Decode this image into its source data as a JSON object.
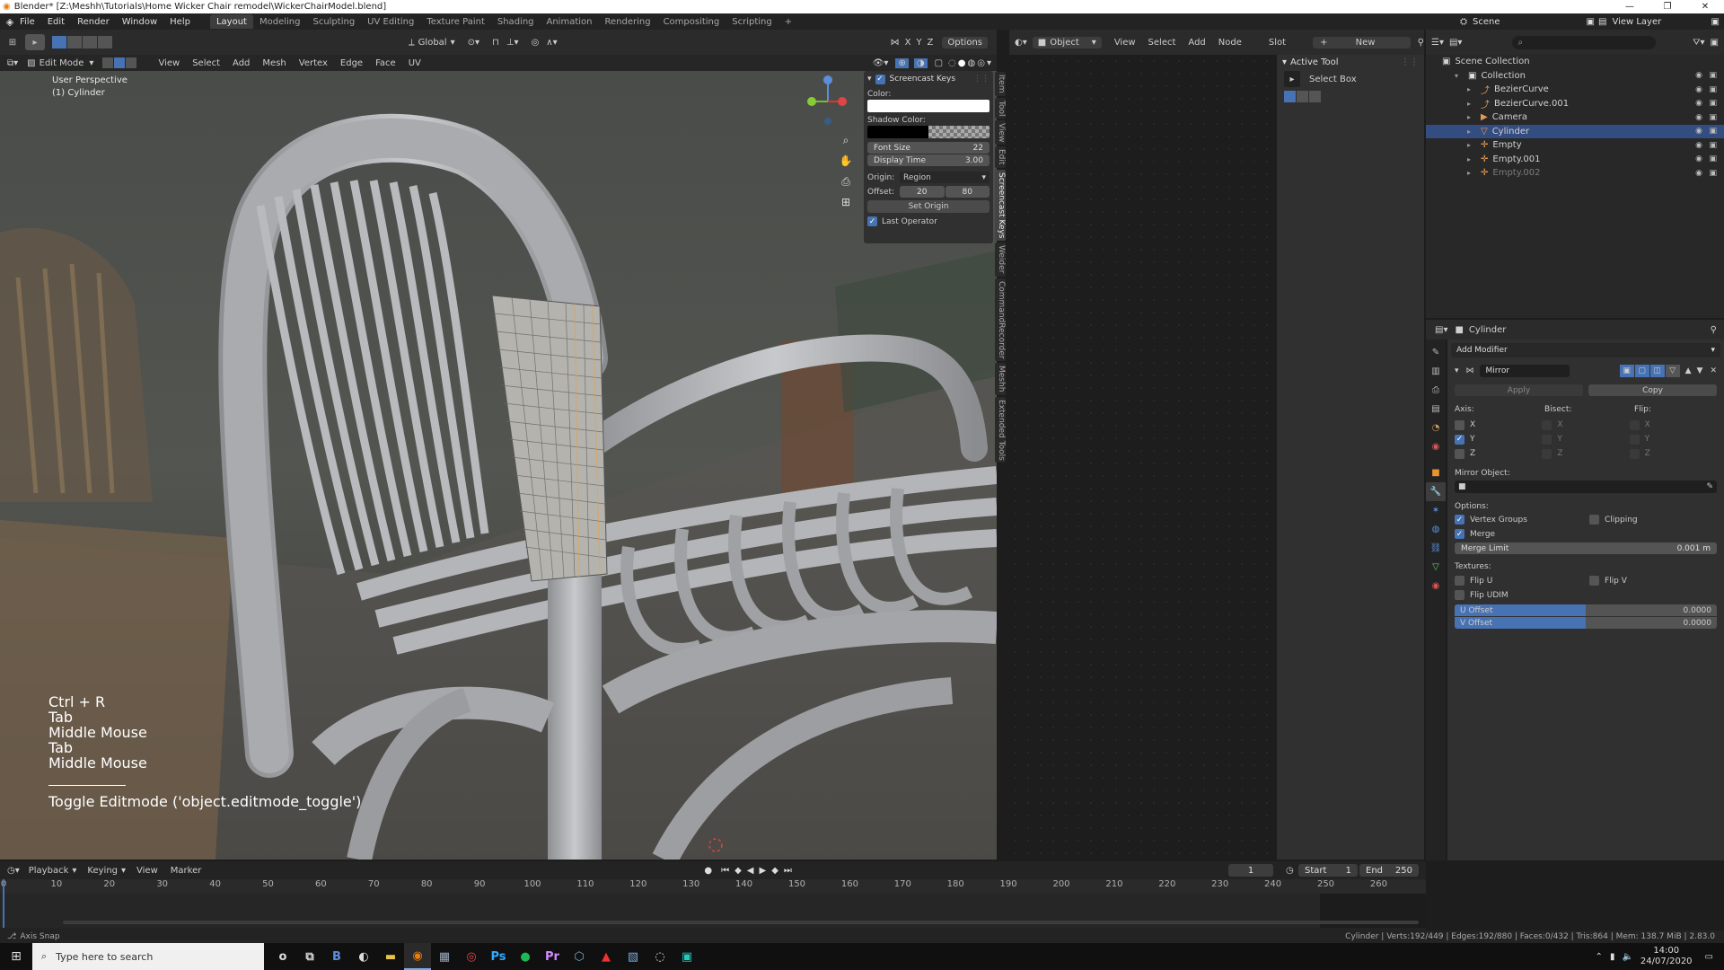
{
  "window": {
    "title": "Blender* [Z:\\Meshh\\Tutorials\\Home Wicker Chair remodel\\WickerChairModel.blend]",
    "controls": [
      "—",
      "❐",
      "✕"
    ]
  },
  "top_menu": [
    "File",
    "Edit",
    "Render",
    "Window",
    "Help"
  ],
  "workspace_tabs": [
    "Layout",
    "Modeling",
    "Sculpting",
    "UV Editing",
    "Texture Paint",
    "Shading",
    "Animation",
    "Rendering",
    "Compositing",
    "Scripting"
  ],
  "workspace_add": "+",
  "scene": {
    "name": "Scene",
    "view_layer": "View Layer"
  },
  "viewport_header": {
    "mode": "Edit Mode",
    "menus": [
      "View",
      "Select",
      "Add",
      "Mesh",
      "Vertex",
      "Edge",
      "Face",
      "UV"
    ],
    "transform": "Global",
    "axes": [
      "X",
      "Y",
      "Z"
    ],
    "options": "Options"
  },
  "viewport": {
    "perspective": "User Perspective",
    "object": "(1) Cylinder",
    "screencast_lines": [
      "Ctrl + R",
      "Tab",
      "Middle Mouse",
      "Tab",
      "Middle Mouse"
    ],
    "last_operator": "Toggle Editmode ('object.editmode_toggle')"
  },
  "screencast_panel": {
    "title": "Screencast Keys",
    "color_label": "Color:",
    "color": "#ffffff",
    "shadow_label": "Shadow Color:",
    "font_size_label": "Font Size",
    "font_size": "22",
    "display_time_label": "Display Time",
    "display_time": "3.00",
    "origin_label": "Origin:",
    "origin": "Region",
    "offset_label": "Offset:",
    "offset_x": "20",
    "offset_y": "80",
    "set_origin": "Set Origin",
    "last_operator": "Last Operator"
  },
  "sidebar_tabs": [
    "Item",
    "Tool",
    "View",
    "Edit",
    "Screencast Keys",
    "Weider",
    "CommandRecorder",
    "Meshh",
    "Extended Tools"
  ],
  "node_header": {
    "mode": "Object",
    "menus": [
      "View",
      "Select",
      "Add",
      "Node"
    ],
    "slot": "Slot",
    "new": "New"
  },
  "active_tool": {
    "title": "Active Tool",
    "tool": "Select Box"
  },
  "outliner": {
    "search_placeholder": "",
    "root": "Scene Collection",
    "items": [
      {
        "name": "Collection",
        "indent": 1,
        "icon": "collection",
        "color": "#e0e0e0"
      },
      {
        "name": "BezierCurve",
        "indent": 2,
        "icon": "curve",
        "color": "#e59c52"
      },
      {
        "name": "BezierCurve.001",
        "indent": 2,
        "icon": "curve",
        "color": "#e59c52"
      },
      {
        "name": "Camera",
        "indent": 2,
        "icon": "camera",
        "color": "#e59c52"
      },
      {
        "name": "Cylinder",
        "indent": 2,
        "icon": "mesh",
        "color": "#e59c52",
        "selected": true
      },
      {
        "name": "Empty",
        "indent": 2,
        "icon": "empty",
        "color": "#e59c52"
      },
      {
        "name": "Empty.001",
        "indent": 2,
        "icon": "empty",
        "color": "#e59c52"
      },
      {
        "name": "Empty.002",
        "indent": 2,
        "icon": "empty",
        "color": "#e59c52",
        "dim": true
      }
    ]
  },
  "properties": {
    "object": "Cylinder",
    "add_modifier": "Add Modifier",
    "modifier_name": "Mirror",
    "apply": "Apply",
    "copy": "Copy",
    "axis_label": "Axis:",
    "bisect_label": "Bisect:",
    "flip_label": "Flip:",
    "axes": [
      {
        "name": "X",
        "axis": false,
        "bisect": false,
        "flip": false
      },
      {
        "name": "Y",
        "axis": true,
        "bisect": false,
        "flip": false
      },
      {
        "name": "Z",
        "axis": false,
        "bisect": false,
        "flip": false
      }
    ],
    "mirror_object_label": "Mirror Object:",
    "options_label": "Options:",
    "vertex_groups": "Vertex Groups",
    "clipping": "Clipping",
    "merge": "Merge",
    "merge_limit_label": "Merge Limit",
    "merge_limit": "0.001 m",
    "textures_label": "Textures:",
    "flip_u": "Flip U",
    "flip_v": "Flip V",
    "flip_udim": "Flip UDIM",
    "u_offset_label": "U Offset",
    "u_offset": "0.0000",
    "v_offset_label": "V Offset",
    "v_offset": "0.0000"
  },
  "timeline": {
    "menus": [
      "Playback",
      "Keying",
      "View",
      "Marker"
    ],
    "current_frame": "1",
    "start_label": "Start",
    "start": "1",
    "end_label": "End",
    "end": "250",
    "ticks": [
      "0",
      "10",
      "20",
      "30",
      "40",
      "50",
      "60",
      "70",
      "80",
      "90",
      "100",
      "110",
      "120",
      "130",
      "140",
      "150",
      "160",
      "170",
      "180",
      "190",
      "200",
      "210",
      "220",
      "230",
      "240",
      "250",
      "260"
    ]
  },
  "status_bar": {
    "left": "Axis Snap",
    "right": "Cylinder | Verts:192/449 | Edges:192/880 | Faces:0/432 | Tris:864 | Mem: 138.7 MiB | 2.83.0"
  },
  "taskbar": {
    "search_placeholder": "Type here to search",
    "apps": [
      "o",
      "⧉",
      "B",
      "◐",
      "▬",
      "◉",
      "▦",
      "◎",
      "Ps",
      "●",
      "Pr",
      "⬡",
      "▲",
      "▧",
      "◌",
      "▣"
    ],
    "time": "14:00",
    "date": "24/07/2020"
  },
  "colors": {
    "accent": "#4772b3",
    "selected_row": "#334d80",
    "bg": "#1d1d1d",
    "panel": "#303030",
    "header": "#232323"
  }
}
